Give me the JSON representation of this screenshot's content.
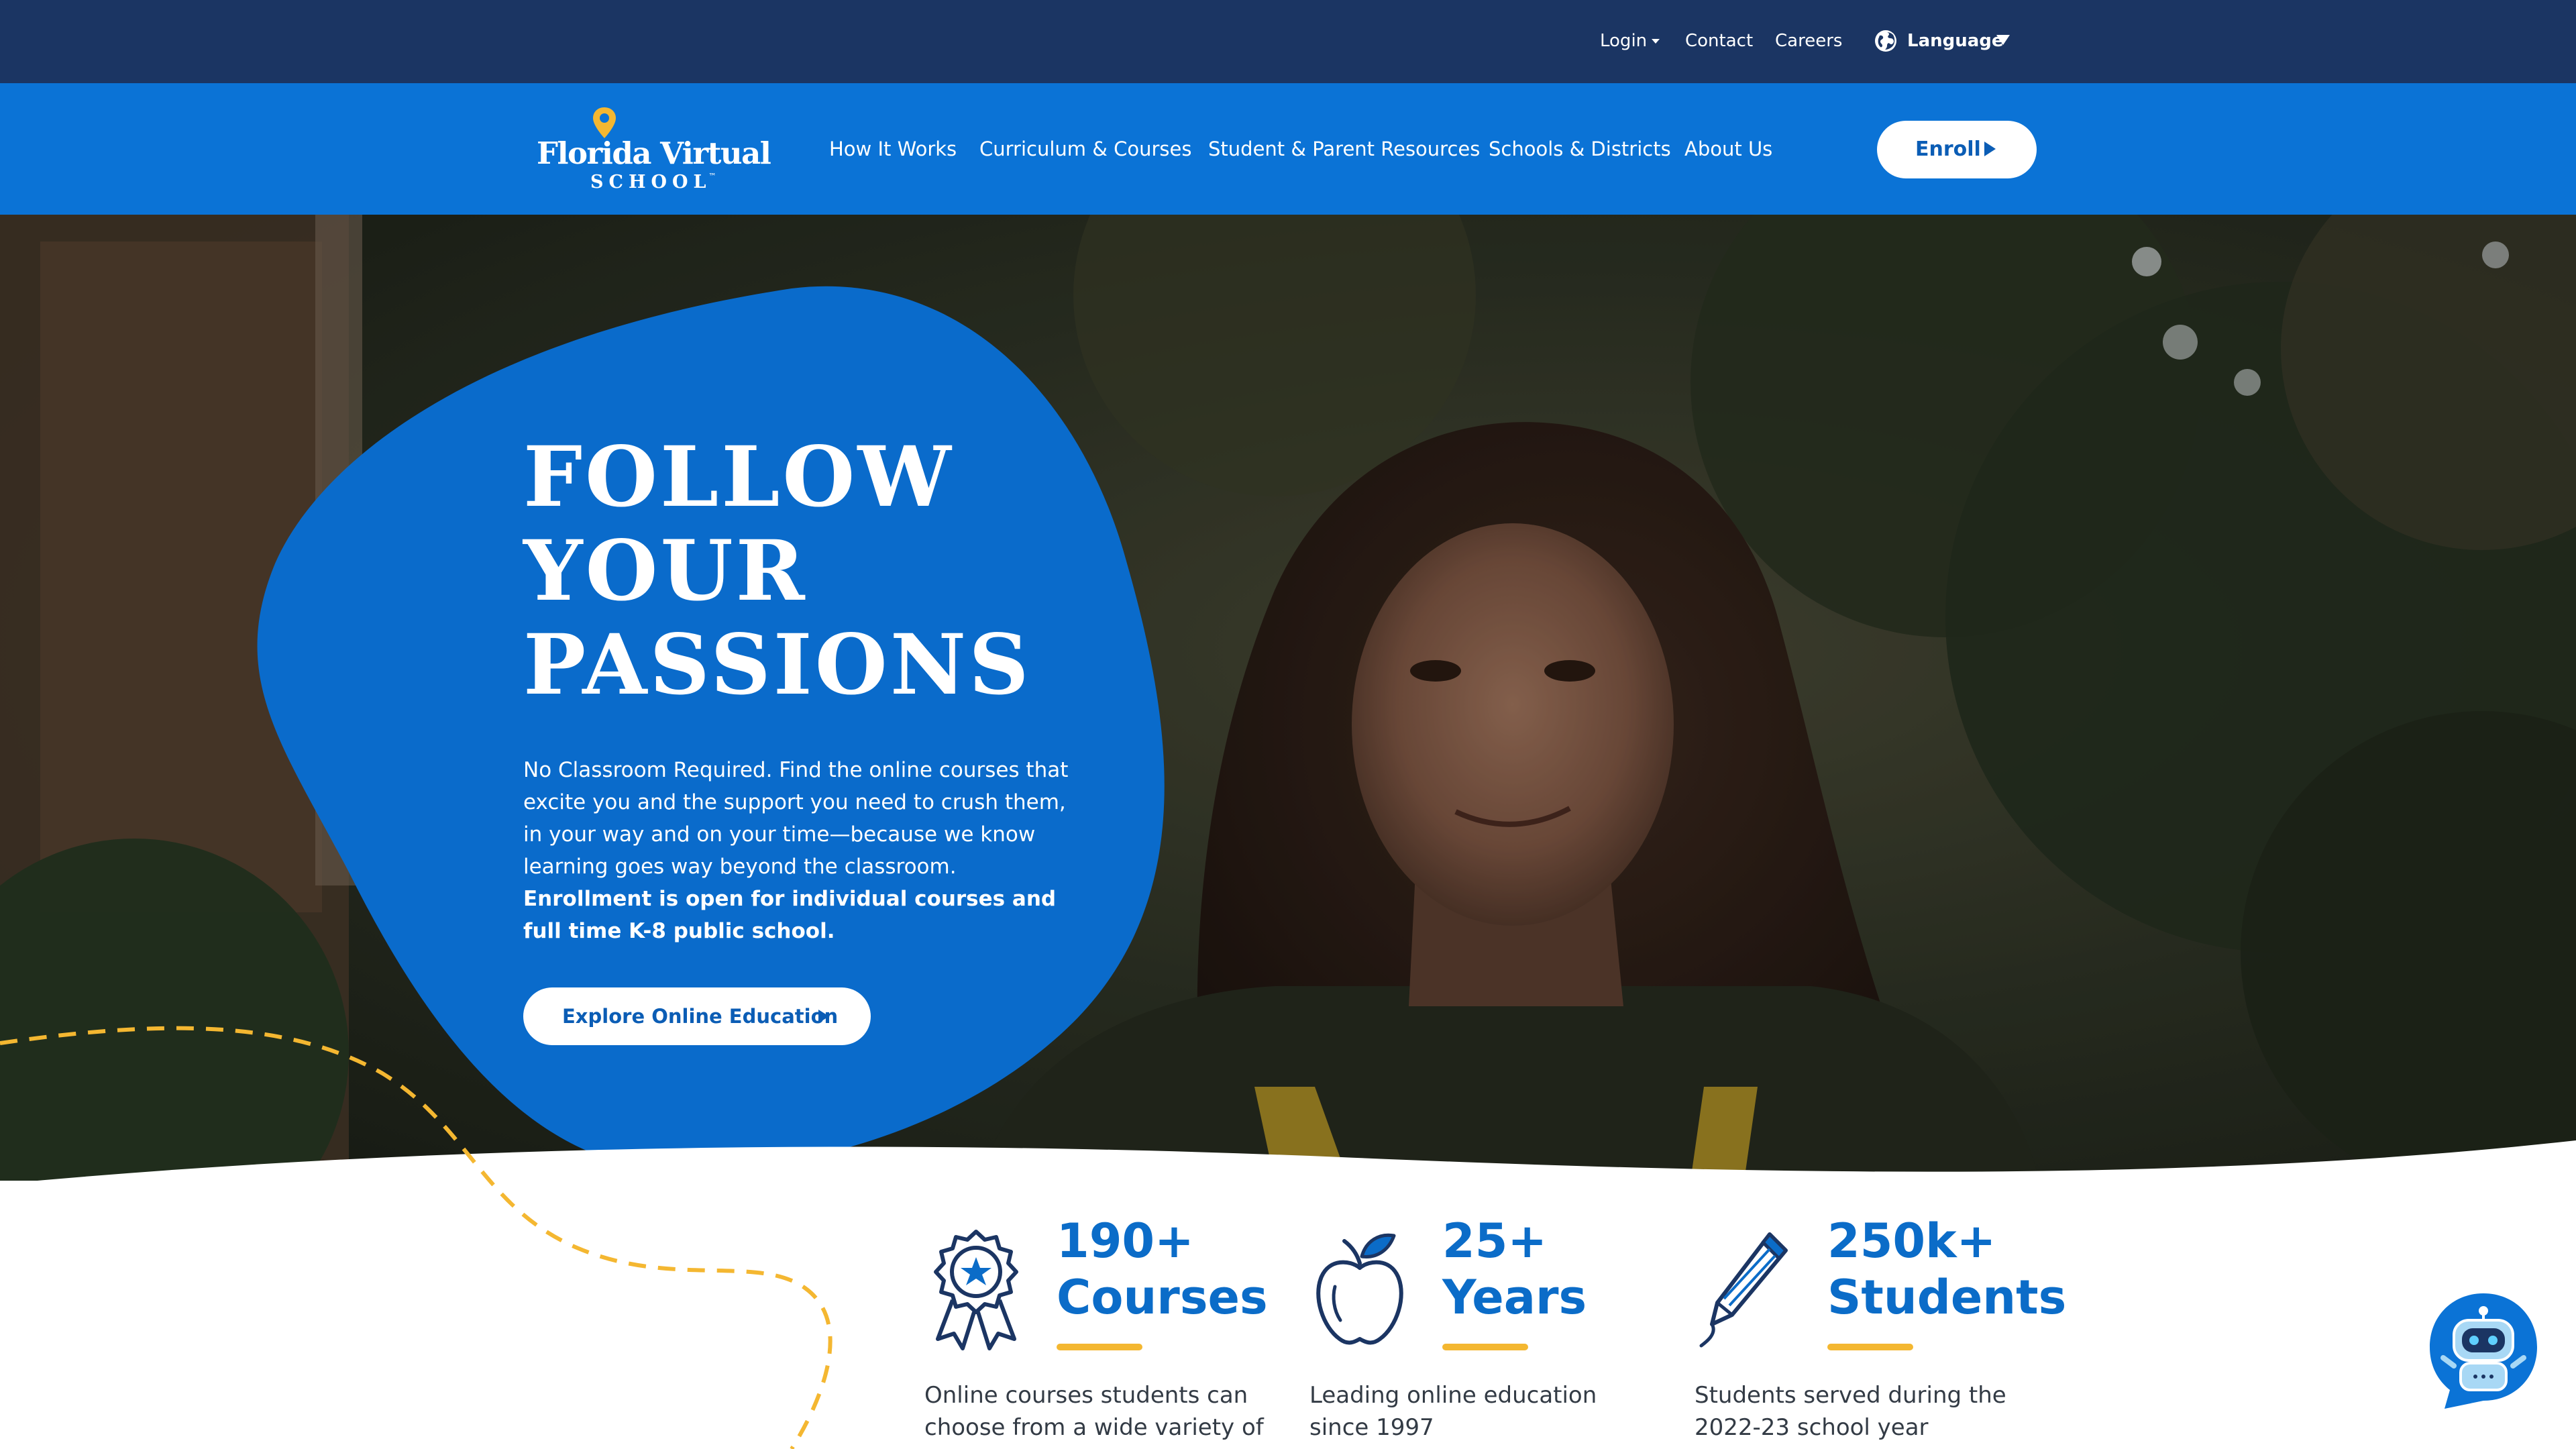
{
  "utility": {
    "login": "Login",
    "contact": "Contact",
    "careers": "Careers",
    "language": "Language"
  },
  "logo": {
    "line1": "Florida Virtual",
    "line2": "SCHOOL",
    "tm": "™"
  },
  "nav": {
    "items": [
      {
        "label": "How It Works"
      },
      {
        "label": "Curriculum & Courses"
      },
      {
        "label": "Student & Parent Resources"
      },
      {
        "label": "Schools & Districts"
      },
      {
        "label": "About Us"
      }
    ],
    "enroll": "Enroll"
  },
  "hero": {
    "title": [
      "FOLLOW",
      "YOUR",
      "PASSIONS"
    ],
    "body": "No Classroom Required. Find the online courses that excite you and the support you need to crush them, in your way and on your time—because we know learning goes way beyond the classroom.",
    "body_bold": "Enrollment is open for individual courses and full time K-8 public school.",
    "cta": "Explore Online Education"
  },
  "stats": [
    {
      "icon": "award-ribbon-icon",
      "number": "190+",
      "unit": "Courses",
      "desc": "Online courses students can choose from a wide variety of"
    },
    {
      "icon": "apple-icon",
      "number": "25+",
      "unit": "Years",
      "desc": "Leading online education since 1997"
    },
    {
      "icon": "pencil-icon",
      "number": "250k+",
      "unit": "Students",
      "desc": "Students served during the 2022-23 school year"
    }
  ],
  "colors": {
    "utility_bar": "#1b3563",
    "nav": "#0b73d6",
    "blob": "#0a6bcb",
    "accent_blue": "#0b6cc8",
    "accent_yellow": "#f4b731",
    "dark_text": "#333b45"
  }
}
